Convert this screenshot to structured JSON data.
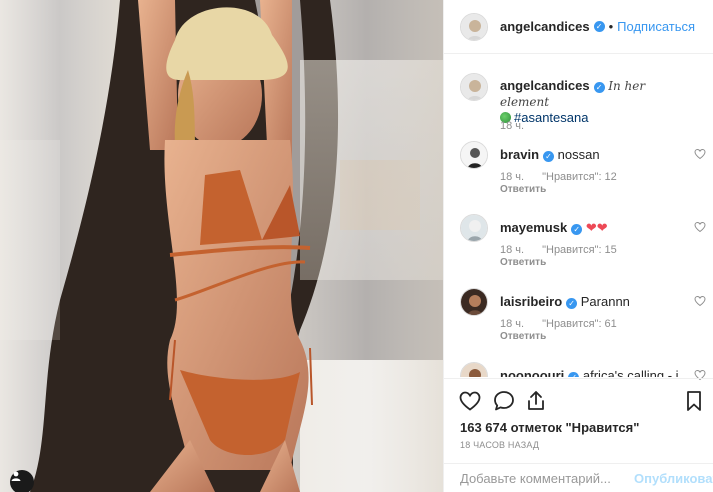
{
  "header": {
    "username": "angelcandices",
    "separator": "•",
    "follow_label": "Подписаться"
  },
  "caption": {
    "username": "angelcandices",
    "text": "In her element",
    "hashtag": "#asantesana",
    "time": "18 ч."
  },
  "comments": [
    {
      "username": "bravin",
      "text": "nossan",
      "time": "18 ч.",
      "likes": "\"Нравится\": 12",
      "reply": "Ответить"
    },
    {
      "username": "mayemusk",
      "text": "❤❤",
      "time": "18 ч.",
      "likes": "\"Нравится\": 15",
      "reply": "Ответить"
    },
    {
      "username": "laisribeiro",
      "text": "Parannn",
      "time": "18 ч.",
      "likes": "\"Нравится\": 61",
      "reply": "Ответить"
    },
    {
      "username": "noonoouri",
      "text": "africa's calling - i"
    }
  ],
  "stats": {
    "likes_text": "163 674 отметок \"Нравится\"",
    "time_text": "18 ЧАСОВ НАЗАД"
  },
  "add_comment": {
    "placeholder": "Добавьте комментарий...",
    "publish_label": "Опубликовать"
  },
  "icons": {
    "like": "heart-icon",
    "comment": "comment-icon",
    "share": "share-icon",
    "save": "bookmark-icon",
    "tag": "person-tag-icon"
  },
  "colors": {
    "accent": "#3897f0",
    "hashtag": "#003569",
    "muted": "#8e8e8e",
    "heart_red": "#ed4956"
  }
}
